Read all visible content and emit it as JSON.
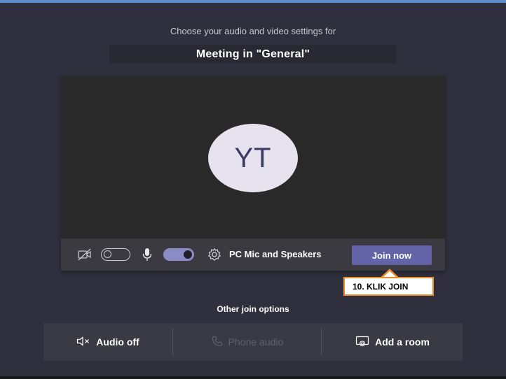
{
  "header": {
    "subtitle": "Choose your audio and video settings for",
    "meeting_title": "Meeting in \"General\""
  },
  "preview": {
    "avatar_initials": "YT"
  },
  "controls": {
    "camera_toggle_state": "off",
    "mic_toggle_state": "on",
    "device_label": "PC Mic and Speakers",
    "join_label": "Join now"
  },
  "annotation": {
    "callout_text": "10. KLIK JOIN",
    "callout_color": "#ed8b2f"
  },
  "other_options": {
    "heading": "Other join options",
    "audio_off": "Audio off",
    "phone_audio": "Phone audio",
    "add_room": "Add a room"
  },
  "colors": {
    "accent": "#6264a7",
    "background": "#2f2f3d"
  }
}
